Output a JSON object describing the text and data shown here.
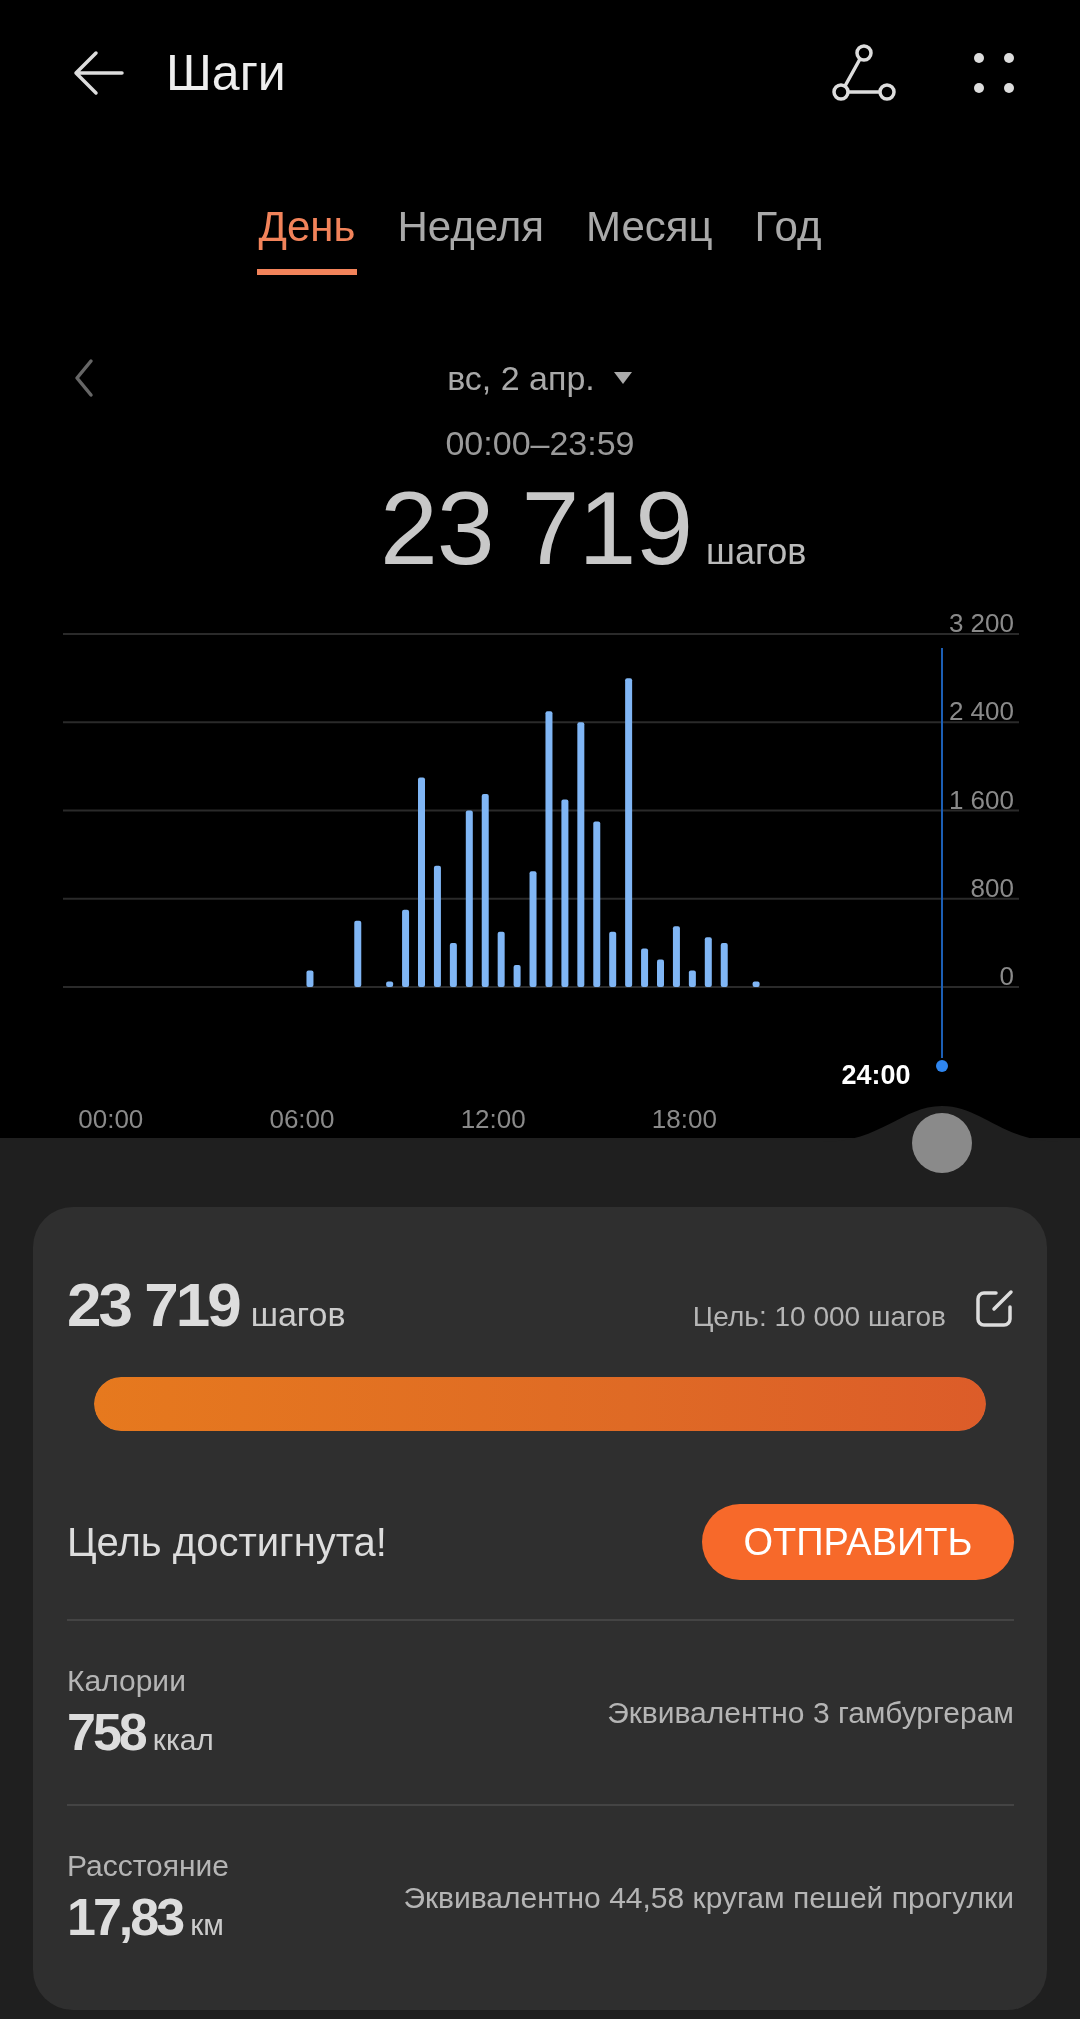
{
  "header": {
    "title": "Шаги"
  },
  "tabs": [
    {
      "label": "День",
      "selected": true
    },
    {
      "label": "Неделя",
      "selected": false
    },
    {
      "label": "Месяц",
      "selected": false
    },
    {
      "label": "Год",
      "selected": false
    }
  ],
  "date": {
    "label": "вс, 2 апр.",
    "time_range": "00:00–23:59"
  },
  "total": {
    "value": "23 719",
    "unit": "шагов"
  },
  "chart": {
    "cursor_label": "24:00",
    "chart_data": {
      "type": "bar",
      "grid": true,
      "xlim": [
        -1.5,
        28.5
      ],
      "x": [
        6.25,
        7.75,
        8.75,
        9.25,
        9.75,
        10.25,
        10.75,
        11.25,
        11.75,
        12.25,
        12.75,
        13.25,
        13.75,
        14.25,
        14.75,
        15.25,
        15.75,
        16.25,
        16.75,
        17.25,
        17.75,
        18.25,
        18.75,
        19.25,
        20.25
      ],
      "values": [
        150,
        600,
        50,
        700,
        1900,
        1100,
        400,
        1600,
        1750,
        500,
        200,
        1050,
        2500,
        1700,
        2400,
        1500,
        500,
        2800,
        350,
        250,
        550,
        150,
        450,
        400,
        50
      ],
      "ylim": [
        0,
        3200
      ],
      "xticks": [
        {
          "value": 0,
          "label": "00:00"
        },
        {
          "value": 6,
          "label": "06:00"
        },
        {
          "value": 12,
          "label": "12:00"
        },
        {
          "value": 18,
          "label": "18:00"
        }
      ],
      "yticks": [
        {
          "value": 0,
          "label": "0"
        },
        {
          "value": 800,
          "label": "800"
        },
        {
          "value": 1600,
          "label": "1 600"
        },
        {
          "value": 2400,
          "label": "2 400"
        },
        {
          "value": 3200,
          "label": "3 200"
        }
      ]
    }
  },
  "summary": {
    "value": "23 719",
    "unit": "шагов",
    "goal": "Цель: 10 000 шагов",
    "level": 1,
    "status": "Цель достигнута!",
    "button": "ОТПРАВИТЬ"
  },
  "stats": [
    {
      "label": "Калории",
      "value": "758",
      "unit": "ккал",
      "equivalent": "Эквивалентно 3 гамбургерам"
    },
    {
      "label": "Расстояние",
      "value": "17,83",
      "unit": "км",
      "equivalent": "Эквивалентно 44,58 кругам пешей прогулки"
    }
  ]
}
